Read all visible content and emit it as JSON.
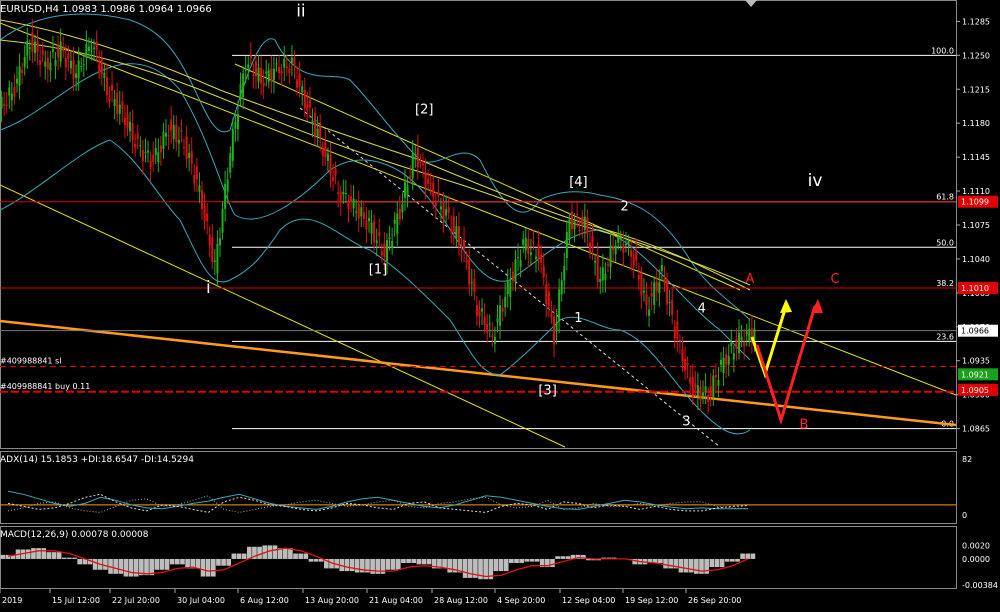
{
  "chart_data": {
    "type": "candlestick",
    "symbol_header": "EURUSD,H4  1.0983 1.0986 1.0964 1.0966",
    "price_axis": {
      "ylim": [
        1.0845,
        1.1305
      ],
      "ticks": [
        "1.1285",
        "1.1250",
        "1.1215",
        "1.1180",
        "1.1145",
        "1.1110",
        "1.1075",
        "1.1040",
        "1.1005",
        "1.0970",
        "1.0935",
        "1.0900",
        "1.0865"
      ]
    },
    "price_labels": [
      {
        "text": "1.1099",
        "price": 1.1099,
        "color": "#e00000"
      },
      {
        "text": "1.1010",
        "price": 1.101,
        "color": "#e00000"
      },
      {
        "text": "1.0966",
        "price": 1.0966,
        "color": "#ffffff",
        "text_color": "#000000"
      },
      {
        "text": "1.0921",
        "price": 1.0921,
        "color": "#1aa01a"
      },
      {
        "text": "1.0905",
        "price": 1.0905,
        "color": "#e00000"
      }
    ],
    "fib_levels": [
      {
        "label": "100.0",
        "price": 1.125
      },
      {
        "label": "61.8",
        "price": 1.1099
      },
      {
        "label": "50.0",
        "price": 1.1052
      },
      {
        "label": "38.2",
        "price": 1.101
      },
      {
        "label": "23.6",
        "price": 1.0955
      },
      {
        "label": "0.0",
        "price": 1.0865
      }
    ],
    "order_lines": [
      {
        "label": "#409988841 sl",
        "price": 1.0929,
        "color": "#e00000"
      },
      {
        "label": "#409988841 buy 0.11",
        "price": 1.0903,
        "color": "#e00000"
      }
    ],
    "wave_labels": [
      {
        "text": "ii",
        "price": 1.129,
        "bar": 19,
        "color": "#ffffff"
      },
      {
        "text": "i",
        "price": 1.1005,
        "bar": 13,
        "color": "#ffffff"
      },
      {
        "text": "[2]",
        "price": 1.119,
        "bar": 27,
        "color": "#ffffff"
      },
      {
        "text": "[1]",
        "price": 1.1025,
        "bar": 24,
        "color": "#ffffff"
      },
      {
        "text": "[4]",
        "price": 1.1115,
        "bar": 37,
        "color": "#ffffff"
      },
      {
        "text": "[3]",
        "price": 1.09,
        "bar": 35,
        "color": "#ffffff"
      },
      {
        "text": "2",
        "price": 1.109,
        "bar": 40,
        "color": "#ffffff"
      },
      {
        "text": "1",
        "price": 1.0975,
        "bar": 37,
        "color": "#ffffff"
      },
      {
        "text": "4",
        "price": 1.0985,
        "bar": 45,
        "color": "#ffffff"
      },
      {
        "text": "3",
        "price": 1.0868,
        "bar": 44,
        "color": "#ffffff"
      },
      {
        "text": "iv",
        "price": 1.1115,
        "bar": 52,
        "color": "#ffffff"
      },
      {
        "text": "A",
        "price": 1.1015,
        "bar": 48,
        "color": "#ff2020"
      },
      {
        "text": "B",
        "price": 1.0865,
        "bar": 51,
        "color": "#ff2020"
      },
      {
        "text": "C",
        "price": 1.1015,
        "bar": 53,
        "color": "#ff2020"
      }
    ],
    "candles_close": [
      1.1215,
      1.1265,
      1.124,
      1.1255,
      1.123,
      1.1265,
      1.1215,
      1.119,
      1.1155,
      1.114,
      1.1175,
      1.116,
      1.111,
      1.103,
      1.115,
      1.1245,
      1.1225,
      1.1235,
      1.124,
      1.1195,
      1.1155,
      1.111,
      1.1095,
      1.1075,
      1.1045,
      1.109,
      1.115,
      1.111,
      1.1085,
      1.1055,
      1.099,
      1.096,
      1.101,
      1.1055,
      1.1045,
      1.096,
      1.108,
      1.1075,
      1.1015,
      1.106,
      1.105,
      1.099,
      1.1025,
      1.0955,
      1.0905,
      1.09,
      1.0935,
      1.0955,
      1.0966
    ],
    "indicator_adx": {
      "label": "ADX(14) 15.1853 +DI:18.6547 -DI:14.5294",
      "scale_ticks": [
        "82",
        "0"
      ],
      "level_line": 20,
      "adx": [
        38,
        34,
        28,
        22,
        18,
        22,
        30,
        26,
        20,
        16,
        15,
        18,
        22,
        25,
        30,
        34,
        28,
        22,
        18,
        16,
        14,
        18,
        24,
        28,
        30,
        26,
        22,
        18,
        16,
        20,
        26,
        32,
        30,
        26,
        22,
        18,
        15,
        14,
        18,
        22,
        26,
        24,
        20,
        17,
        15,
        16,
        15,
        15,
        15
      ],
      "plus_di": [
        22,
        18,
        14,
        16,
        22,
        30,
        34,
        24,
        16,
        12,
        20,
        18,
        14,
        10,
        24,
        30,
        26,
        20,
        18,
        14,
        12,
        16,
        22,
        20,
        16,
        14,
        22,
        24,
        16,
        14,
        12,
        10,
        18,
        22,
        20,
        14,
        24,
        22,
        16,
        20,
        18,
        14,
        18,
        14,
        12,
        12,
        16,
        18,
        19
      ],
      "minus_di": [
        12,
        16,
        22,
        24,
        16,
        12,
        10,
        18,
        26,
        28,
        18,
        20,
        26,
        32,
        14,
        10,
        14,
        18,
        20,
        24,
        26,
        22,
        18,
        20,
        24,
        26,
        18,
        16,
        22,
        24,
        28,
        30,
        20,
        16,
        18,
        26,
        14,
        16,
        22,
        18,
        18,
        22,
        18,
        22,
        24,
        24,
        18,
        16,
        15
      ]
    },
    "indicator_macd": {
      "label": "MACD(12,26,9) 0.00078 0.00008",
      "scale_ticks": [
        "0.0020",
        "0.0000",
        "-0.00384"
      ],
      "histogram": [
        0.0006,
        0.0014,
        0.0016,
        0.001,
        0.0002,
        -0.0008,
        -0.0016,
        -0.0022,
        -0.0026,
        -0.0024,
        -0.0016,
        -0.0008,
        -0.0014,
        -0.0026,
        -0.001,
        0.0008,
        0.0018,
        0.002,
        0.0016,
        0.0008,
        -0.0004,
        -0.0014,
        -0.0018,
        -0.002,
        -0.0022,
        -0.0016,
        -0.0006,
        -0.0008,
        -0.0014,
        -0.002,
        -0.0028,
        -0.003,
        -0.0018,
        -0.0006,
        -0.0004,
        -0.0012,
        0.0004,
        0.0006,
        -0.0002,
        0.0002,
        0.0,
        -0.0008,
        -0.0006,
        -0.0014,
        -0.002,
        -0.0022,
        -0.0012,
        -0.0004,
        0.0008
      ],
      "signal": [
        0.0004,
        0.0008,
        0.0012,
        0.0012,
        0.0008,
        0.0,
        -0.0008,
        -0.0014,
        -0.002,
        -0.0022,
        -0.002,
        -0.0014,
        -0.0012,
        -0.0018,
        -0.0016,
        -0.0006,
        0.0004,
        0.0012,
        0.0016,
        0.0012,
        0.0004,
        -0.0006,
        -0.0012,
        -0.0016,
        -0.0018,
        -0.0018,
        -0.0012,
        -0.001,
        -0.0012,
        -0.0016,
        -0.0022,
        -0.0026,
        -0.0024,
        -0.0016,
        -0.001,
        -0.001,
        -0.0004,
        0.0002,
        0.0,
        0.0,
        0.0,
        -0.0004,
        -0.0006,
        -0.001,
        -0.0014,
        -0.0018,
        -0.0016,
        -0.001,
        0.0
      ]
    },
    "time_axis": [
      "2019",
      "15 Jul 12:00",
      "22 Jul 20:00",
      "30 Jul 04:00",
      "6 Aug 12:00",
      "13 Aug 20:00",
      "21 Aug 04:00",
      "28 Aug 12:00",
      "4 Sep 20:00",
      "12 Sep 04:00",
      "19 Sep 12:00",
      "26 Sep 20:00"
    ],
    "colors": {
      "background": "#000000",
      "bull": "#1db31d",
      "bear": "#e01010",
      "bollinger": "#3aa7b8",
      "ma": "#d9d94a",
      "channel": "#e6e600",
      "trend_orange": "#ff9a1a",
      "fib_line": "#ffffff",
      "grid": "#ffffff",
      "arrow_yellow": "#ffff00",
      "arrow_red": "#ff2020"
    }
  }
}
